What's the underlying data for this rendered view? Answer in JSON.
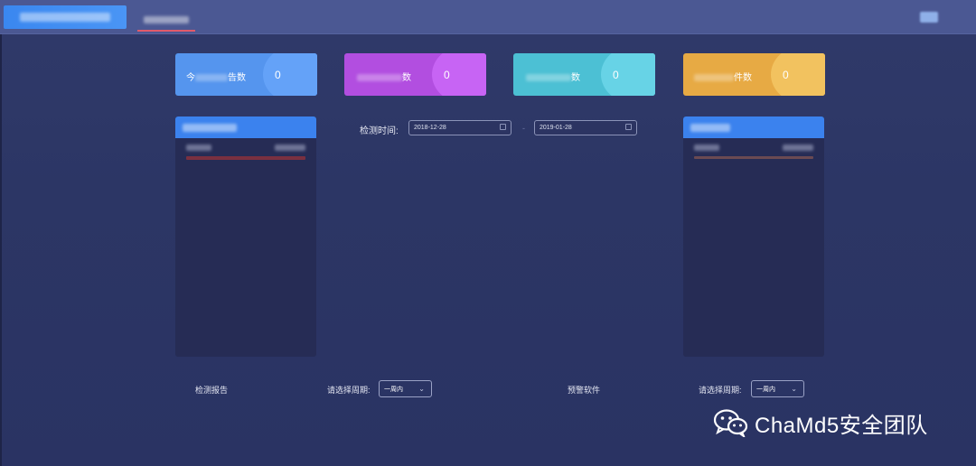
{
  "header": {
    "brand_icon": "logo-blurred",
    "active_tab_indicator_color": "#e05a6a"
  },
  "stats": [
    {
      "label": "今",
      "label_suffix": "告数",
      "value": "0",
      "color": "#5595ee"
    },
    {
      "label": "",
      "label_suffix": "数",
      "value": "0",
      "color": "#b24ee0"
    },
    {
      "label": "",
      "label_suffix": "数",
      "value": "0",
      "color": "#4cc0d4"
    },
    {
      "label": "",
      "label_suffix": "件数",
      "value": "0",
      "color": "#e7aa44"
    }
  ],
  "date_filter": {
    "label": "检测时间:",
    "start": "2018-12-28",
    "end": "2019-01-28",
    "separator": "-"
  },
  "bottom": {
    "left_title": "检测报告",
    "left_period_label": "请选择周期:",
    "left_period_value": "一周内",
    "right_title": "预警软件",
    "right_period_label": "请选择周期:",
    "right_period_value": "一周内"
  },
  "watermark": {
    "text": "ChaMd5安全团队",
    "icon": "wechat-icon"
  }
}
